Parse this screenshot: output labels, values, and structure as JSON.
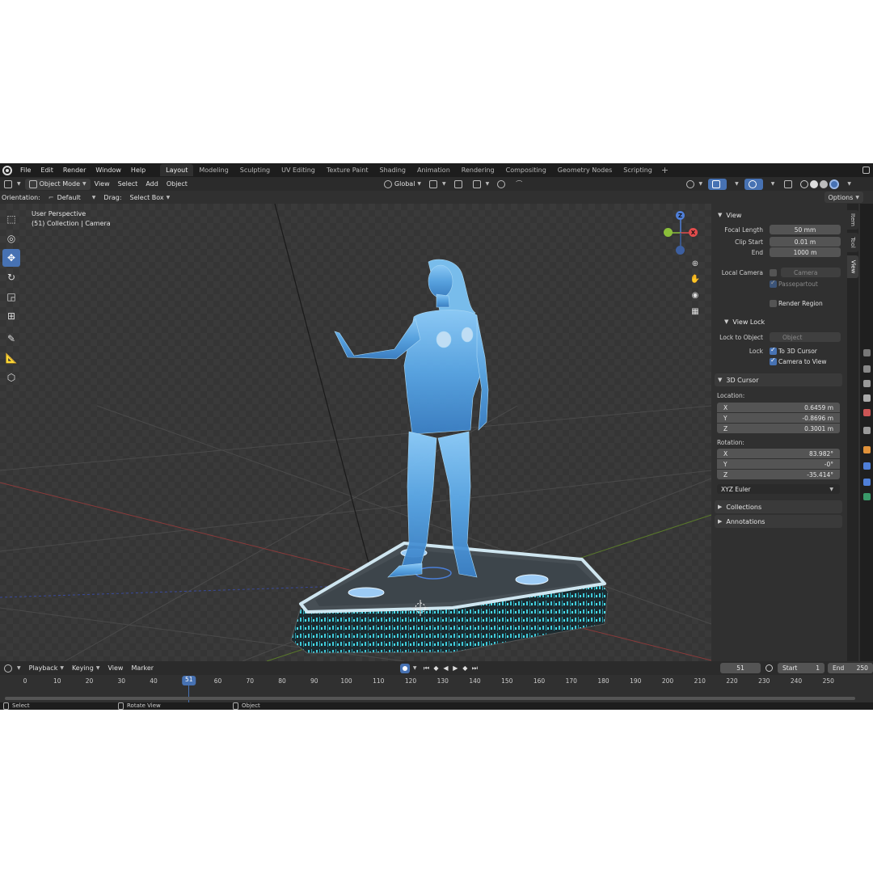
{
  "menu": {
    "items": [
      "File",
      "Edit",
      "Render",
      "Window",
      "Help"
    ]
  },
  "workspaces": {
    "tabs": [
      "Layout",
      "Modeling",
      "Sculpting",
      "UV Editing",
      "Texture Paint",
      "Shading",
      "Animation",
      "Rendering",
      "Compositing",
      "Geometry Nodes",
      "Scripting"
    ],
    "active": "Layout",
    "add": "+"
  },
  "header": {
    "mode": "Object Mode",
    "view": "View",
    "select": "Select",
    "add": "Add",
    "object": "Object",
    "transform": "Global",
    "options": "Options"
  },
  "toolrow": {
    "orientation_label": "Orientation:",
    "orientation_value": "Default",
    "drag_label": "Drag:",
    "drag_value": "Select Box"
  },
  "viewport": {
    "perspective": "User Perspective",
    "collection": "(51) Collection | Camera"
  },
  "gizmo": {
    "z": "Z",
    "x": "X"
  },
  "npanel": {
    "view": {
      "title": "View",
      "focal_length_label": "Focal Length",
      "focal_length": "50 mm",
      "clip_start_label": "Clip Start",
      "clip_start": "0.01 m",
      "end_label": "End",
      "end": "1000 m",
      "local_camera_label": "Local Camera",
      "local_camera_placeholder": "Camera",
      "passepartout": "Passepartout",
      "render_region": "Render Region"
    },
    "view_lock": {
      "title": "View Lock",
      "lock_to_object_label": "Lock to Object",
      "lock_to_object_placeholder": "Object",
      "lock_label": "Lock",
      "to_3d_cursor": "To 3D Cursor",
      "camera_to_view": "Camera to View"
    },
    "cursor": {
      "title": "3D Cursor",
      "location_label": "Location:",
      "loc_x": "0.6459 m",
      "loc_y": "-0.8696 m",
      "loc_z": "0.3001 m",
      "rotation_label": "Rotation:",
      "rot_x": "83.982°",
      "rot_y": "-0°",
      "rot_z": "-35.414°",
      "rotation_mode": "XYZ Euler",
      "axis_x": "X",
      "axis_y": "Y",
      "axis_z": "Z"
    },
    "collections": "Collections",
    "annotations": "Annotations"
  },
  "vtabs": {
    "item": "Item",
    "tool": "Tool",
    "view": "View"
  },
  "timeline": {
    "playback": "Playback",
    "keying": "Keying",
    "view": "View",
    "marker": "Marker",
    "current_frame": "51",
    "start_label": "Start",
    "start": "1",
    "end_label": "End",
    "end": "250",
    "ticks": [
      "0",
      "10",
      "20",
      "30",
      "40",
      "51",
      "60",
      "70",
      "80",
      "90",
      "100",
      "110",
      "120",
      "130",
      "140",
      "150",
      "160",
      "170",
      "180",
      "190",
      "200",
      "210",
      "220",
      "230",
      "240",
      "250"
    ]
  },
  "status": {
    "select": "Select",
    "rotate": "Rotate View",
    "object": "Object"
  },
  "colors": {
    "accent": "#4772b3",
    "hologram": "#5aa8e8",
    "axis_red": "#e24c4c",
    "axis_green": "#8bbf3a",
    "axis_blue": "#4f7fd8"
  }
}
